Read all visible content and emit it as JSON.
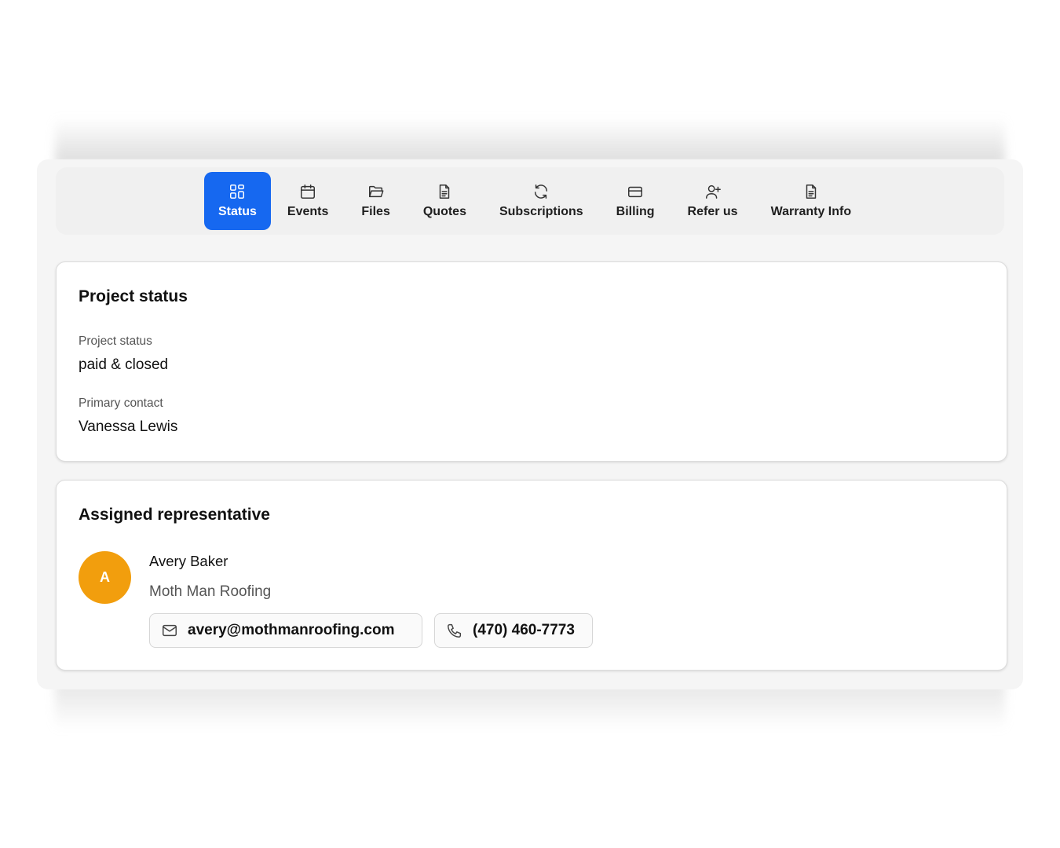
{
  "tabs": [
    {
      "label": "Status",
      "icon": "grid-icon",
      "active": true
    },
    {
      "label": "Events",
      "icon": "calendar-icon",
      "active": false
    },
    {
      "label": "Files",
      "icon": "folder-icon",
      "active": false
    },
    {
      "label": "Quotes",
      "icon": "document-icon",
      "active": false
    },
    {
      "label": "Subscriptions",
      "icon": "refresh-icon",
      "active": false
    },
    {
      "label": "Billing",
      "icon": "credit-card-icon",
      "active": false
    },
    {
      "label": "Refer us",
      "icon": "user-plus-icon",
      "active": false
    },
    {
      "label": "Warranty Info",
      "icon": "document-icon",
      "active": false
    }
  ],
  "project_status": {
    "title": "Project status",
    "status_label": "Project status",
    "status_value": "paid & closed",
    "contact_label": "Primary contact",
    "contact_value": "Vanessa Lewis"
  },
  "representative": {
    "title": "Assigned representative",
    "avatar_initial": "A",
    "name": "Avery Baker",
    "company": "Moth Man Roofing",
    "email": "avery@mothmanroofing.com",
    "phone": "(470) 460-7773"
  },
  "colors": {
    "accent": "#1668f0",
    "avatar": "#f29e0d"
  }
}
